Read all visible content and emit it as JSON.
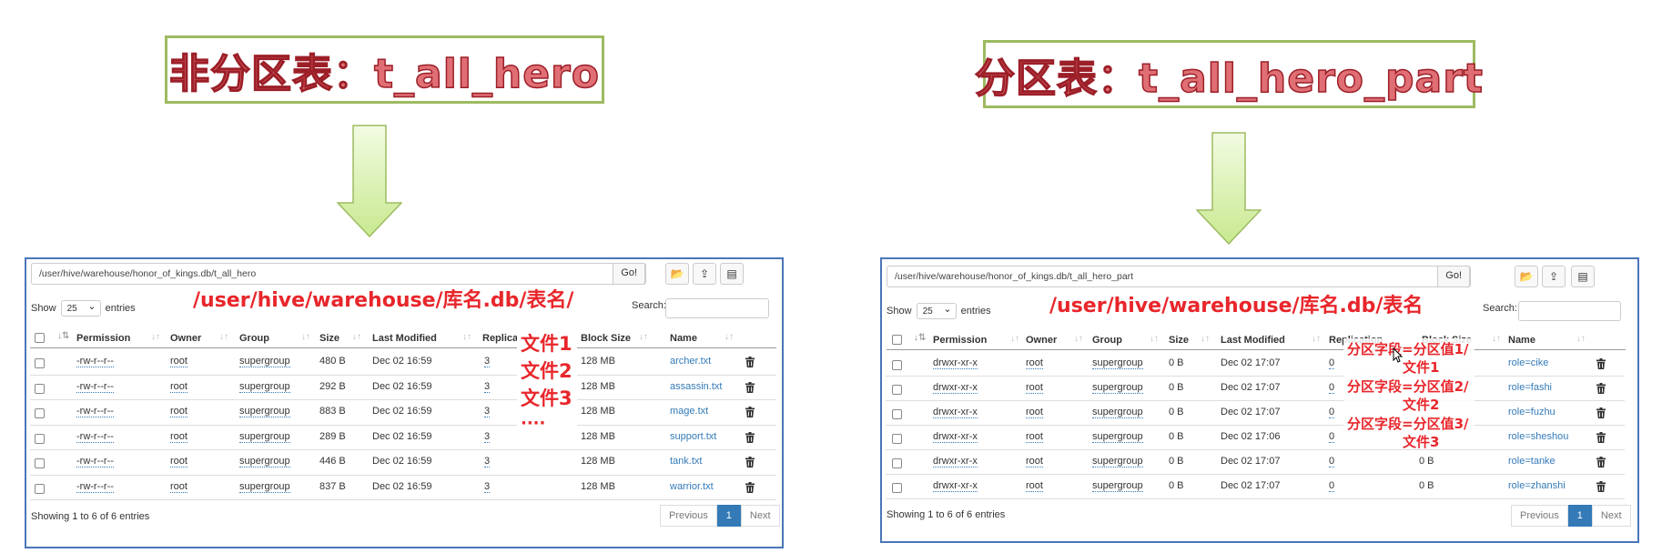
{
  "left": {
    "title": "非分区表：t_all_hero",
    "path": "/user/hive/warehouse/honor_of_kings.db/t_all_hero",
    "go_label": "Go!",
    "show_label": "Show",
    "show_value": "25",
    "entries_label": "entries",
    "search_label": "Search:",
    "annotation_path": "/user/hive/warehouse/库名.db/表名/",
    "annotation_files": [
      "文件1",
      "文件2",
      "文件3",
      "····"
    ],
    "columns": [
      "Permission",
      "Owner",
      "Group",
      "Size",
      "Last Modified",
      "Replicatio",
      "Block Size",
      "Name"
    ],
    "rows": [
      {
        "permission": "-rw-r--r--",
        "owner": "root",
        "group": "supergroup",
        "size": "480 B",
        "modified": "Dec 02 16:59",
        "replication": "3",
        "block": "128 MB",
        "name": "archer.txt"
      },
      {
        "permission": "-rw-r--r--",
        "owner": "root",
        "group": "supergroup",
        "size": "292 B",
        "modified": "Dec 02 16:59",
        "replication": "3",
        "block": "128 MB",
        "name": "assassin.txt"
      },
      {
        "permission": "-rw-r--r--",
        "owner": "root",
        "group": "supergroup",
        "size": "883 B",
        "modified": "Dec 02 16:59",
        "replication": "3",
        "block": "128 MB",
        "name": "mage.txt"
      },
      {
        "permission": "-rw-r--r--",
        "owner": "root",
        "group": "supergroup",
        "size": "289 B",
        "modified": "Dec 02 16:59",
        "replication": "3",
        "block": "128 MB",
        "name": "support.txt"
      },
      {
        "permission": "-rw-r--r--",
        "owner": "root",
        "group": "supergroup",
        "size": "446 B",
        "modified": "Dec 02 16:59",
        "replication": "3",
        "block": "128 MB",
        "name": "tank.txt"
      },
      {
        "permission": "-rw-r--r--",
        "owner": "root",
        "group": "supergroup",
        "size": "837 B",
        "modified": "Dec 02 16:59",
        "replication": "3",
        "block": "128 MB",
        "name": "warrior.txt"
      }
    ],
    "footer": "Showing 1 to 6 of 6 entries",
    "pager": {
      "prev": "Previous",
      "page": "1",
      "next": "Next"
    }
  },
  "right": {
    "title": "分区表：t_all_hero_part",
    "path": "/user/hive/warehouse/honor_of_kings.db/t_all_hero_part",
    "go_label": "Go!",
    "show_label": "Show",
    "show_value": "25",
    "entries_label": "entries",
    "search_label": "Search:",
    "annotation_path": "/user/hive/warehouse/库名.db/表名",
    "annotation_parts": [
      "分区字段=分区值1/",
      "文件1",
      "分区字段=分区值2/",
      "文件2",
      "分区字段=分区值3/",
      "文件3"
    ],
    "columns": [
      "Permission",
      "Owner",
      "Group",
      "Size",
      "Last Modified",
      "Replication",
      "Block Size",
      "Name"
    ],
    "rows": [
      {
        "permission": "drwxr-xr-x",
        "owner": "root",
        "group": "supergroup",
        "size": "0 B",
        "modified": "Dec 02 17:07",
        "replication": "0",
        "block": "",
        "name": "role=cike"
      },
      {
        "permission": "drwxr-xr-x",
        "owner": "root",
        "group": "supergroup",
        "size": "0 B",
        "modified": "Dec 02 17:07",
        "replication": "0",
        "block": "",
        "name": "role=fashi"
      },
      {
        "permission": "drwxr-xr-x",
        "owner": "root",
        "group": "supergroup",
        "size": "0 B",
        "modified": "Dec 02 17:07",
        "replication": "0",
        "block": "",
        "name": "role=fuzhu"
      },
      {
        "permission": "drwxr-xr-x",
        "owner": "root",
        "group": "supergroup",
        "size": "0 B",
        "modified": "Dec 02 17:06",
        "replication": "0",
        "block": "",
        "name": "role=sheshou"
      },
      {
        "permission": "drwxr-xr-x",
        "owner": "root",
        "group": "supergroup",
        "size": "0 B",
        "modified": "Dec 02 17:07",
        "replication": "0",
        "block": "0 B",
        "name": "role=tanke"
      },
      {
        "permission": "drwxr-xr-x",
        "owner": "root",
        "group": "supergroup",
        "size": "0 B",
        "modified": "Dec 02 17:07",
        "replication": "0",
        "block": "0 B",
        "name": "role=zhanshi"
      }
    ],
    "footer": "Showing 1 to 6 of 6 entries",
    "pager": {
      "prev": "Previous",
      "page": "1",
      "next": "Next"
    }
  },
  "colors": {
    "title_fill": "#e06f75",
    "title_stroke": "#9c1f28",
    "box_border": "#9dbb61",
    "arrow_fill": "#d7f0a8",
    "panel_border": "#4a76b8",
    "link": "#337ab7",
    "annotation": "#e8262b"
  }
}
